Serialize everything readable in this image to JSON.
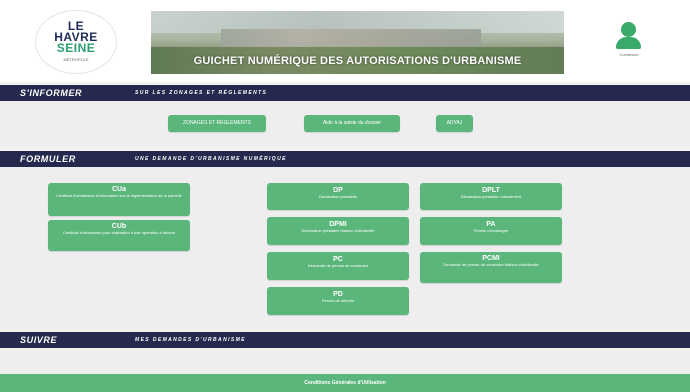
{
  "header": {
    "logo": {
      "line1": "LE",
      "line2": "HAVRE",
      "line3": "SEINE",
      "line4": "MÉTROPOLE"
    },
    "banner_title": "GUICHET NUMÉRIQUE DES AUTORISATIONS D'URBANISME",
    "login_label": "Connexion"
  },
  "sections": {
    "informer": {
      "heading": "S'INFORMER",
      "subheading": "SUR LES ZONAGES ET RÈGLEMENTS",
      "buttons": [
        "ZONAGES ET RÈGLEMENTS",
        "Aide à la saisie du dossier",
        "ADYAJ"
      ]
    },
    "formuler": {
      "heading": "FORMULER",
      "subheading": "UNE DEMANDE D'URBANISME NUMÉRIQUE",
      "cards": [
        {
          "title": "CUa",
          "desc": "Certificat d'urbanisme d'information sur la réglementation de la parcelle"
        },
        {
          "title": "CUb",
          "desc": "Certificat d'urbanisme pour réalisation d'une opération à décrire"
        },
        {
          "title": "DP",
          "desc": "Déclaration préalable"
        },
        {
          "title": "DPLT",
          "desc": "Déclaration préalable Lotissement"
        },
        {
          "title": "DPMI",
          "desc": "Déclaration préalable Maison Individuelle"
        },
        {
          "title": "PA",
          "desc": "Permis d'aménager"
        },
        {
          "title": "PC",
          "desc": "Demande de permis de construire"
        },
        {
          "title": "PCMI",
          "desc": "Demande de permis de construire Maison individuelle"
        },
        {
          "title": "PD",
          "desc": "Permis de démolir"
        }
      ]
    },
    "suivre": {
      "heading": "SUIVRE",
      "subheading": "MES DEMANDES D'URBANISME"
    }
  },
  "footer": {
    "label": "Conditions Générales d'Utilisation"
  },
  "colors": {
    "navy": "#24294d",
    "green": "#5ab67b",
    "background": "#eeeeee"
  }
}
